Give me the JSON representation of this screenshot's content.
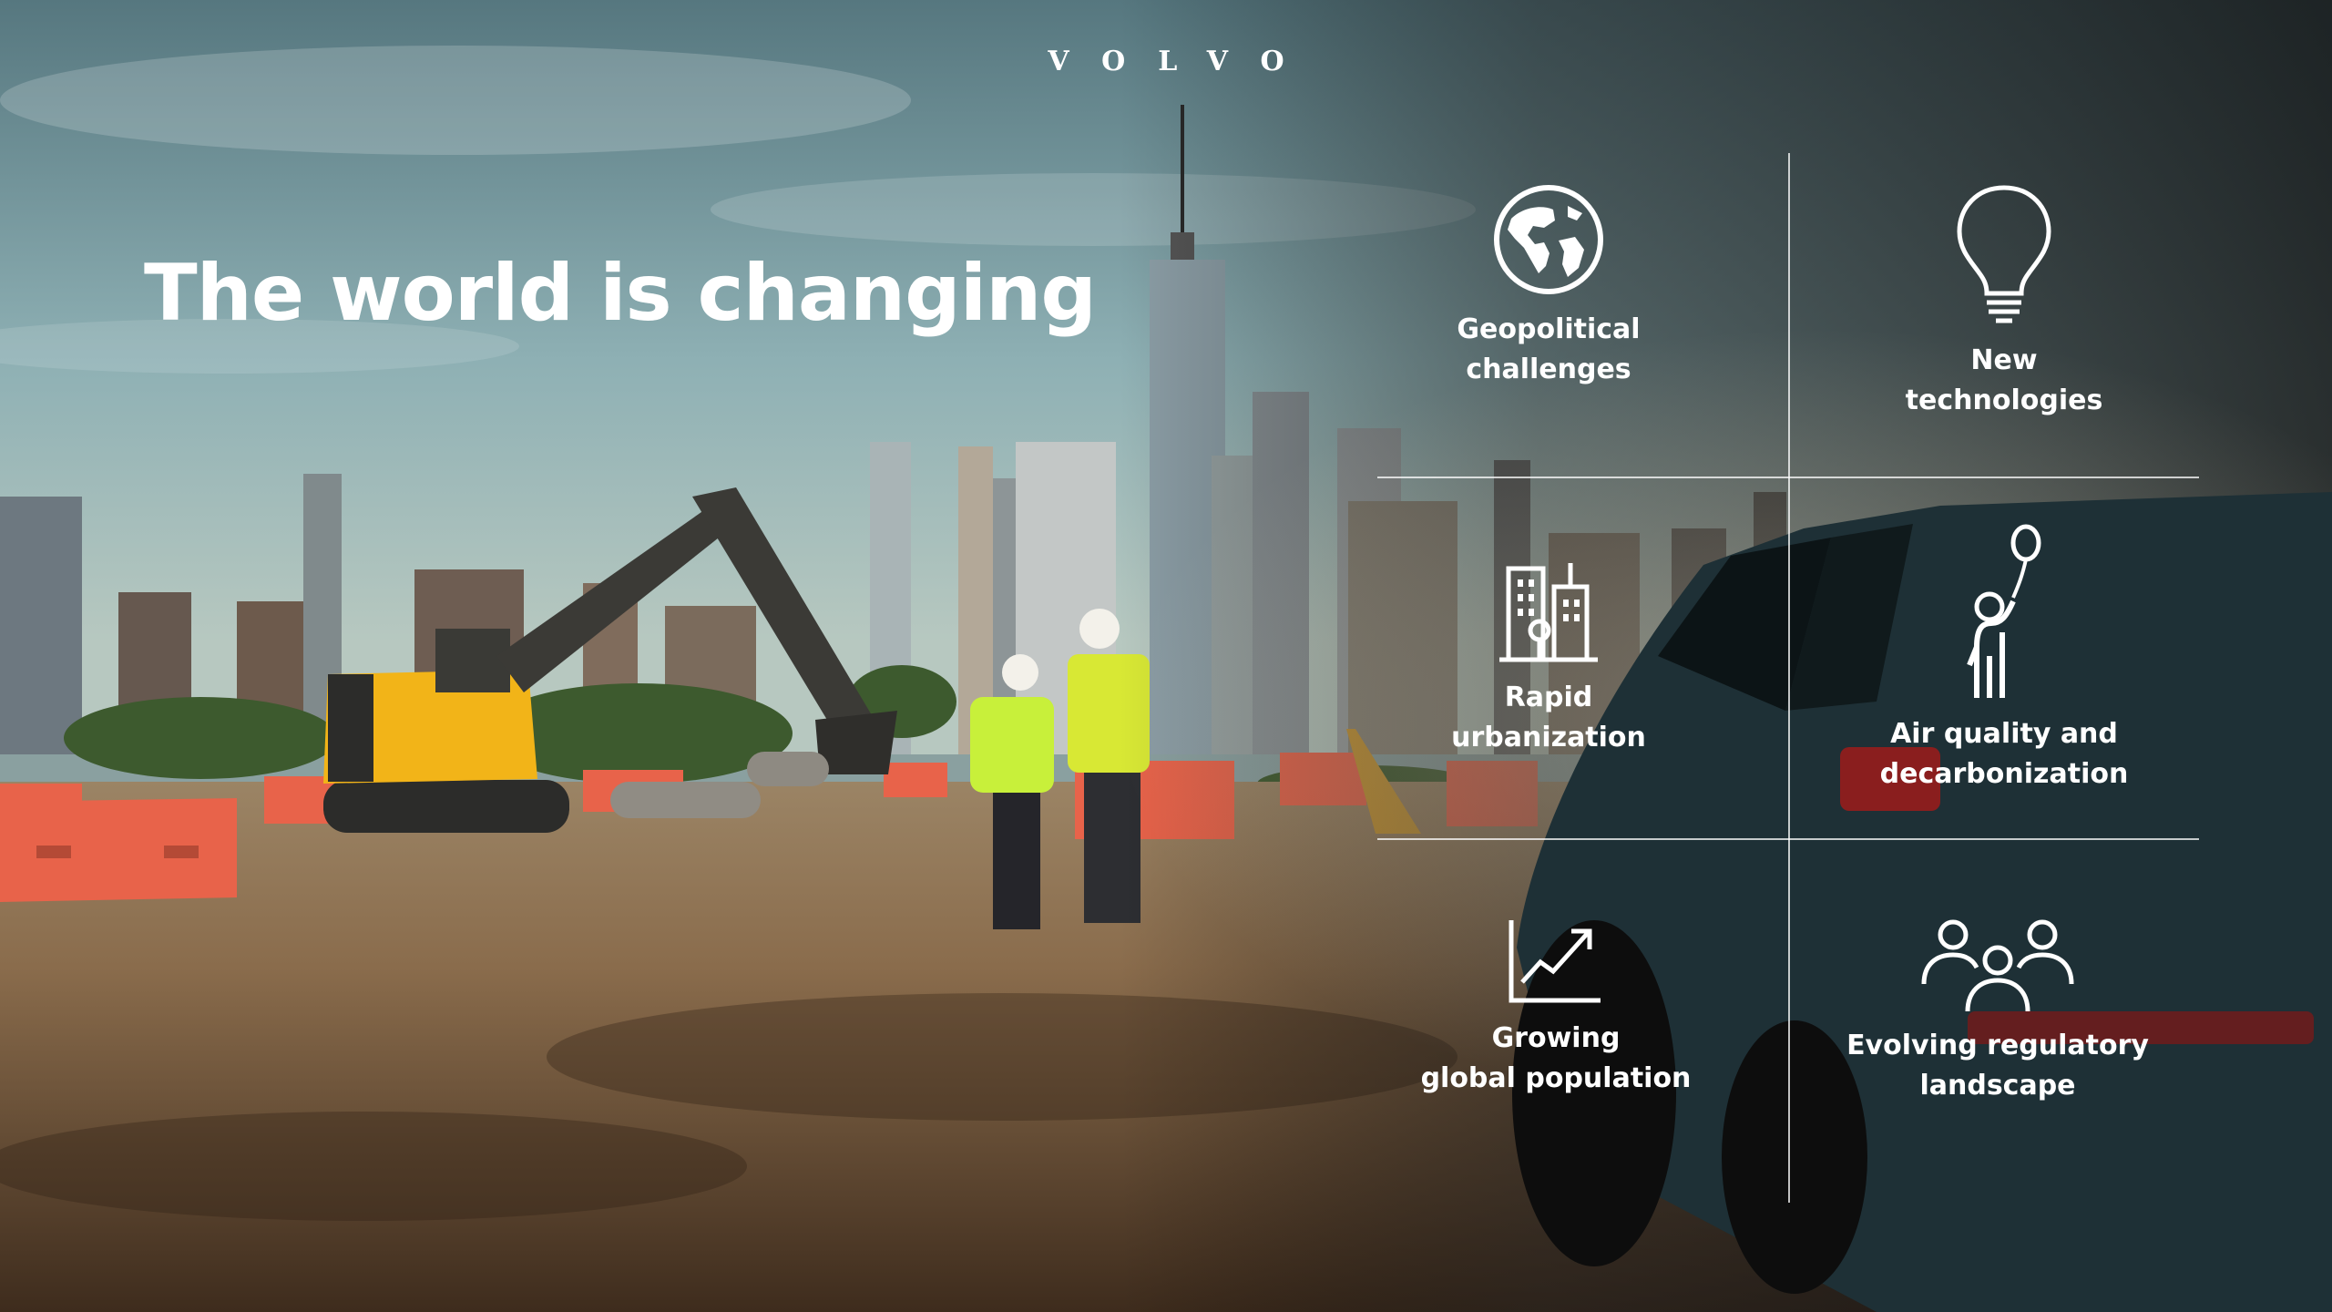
{
  "brand": {
    "logo_text": "VOLVO"
  },
  "headline": "The world is changing",
  "colors": {
    "text": "#ffffff",
    "barrier": "#e8634a",
    "machine_yellow": "#f2b418",
    "vest": "#c8f03a",
    "car_body": "#1e3036"
  },
  "challenges": [
    {
      "icon": "globe-icon",
      "label": "Geopolitical\nchallenges"
    },
    {
      "icon": "lightbulb-icon",
      "label": "New\ntechnologies"
    },
    {
      "icon": "city-buildings-icon",
      "label": "Rapid\nurbanization"
    },
    {
      "icon": "person-balloon-icon",
      "label": "Air quality and\ndecarbonization"
    },
    {
      "icon": "growth-chart-icon",
      "label": "Growing\nglobal population"
    },
    {
      "icon": "people-group-icon",
      "label": "Evolving regulatory\nlandscape"
    }
  ]
}
